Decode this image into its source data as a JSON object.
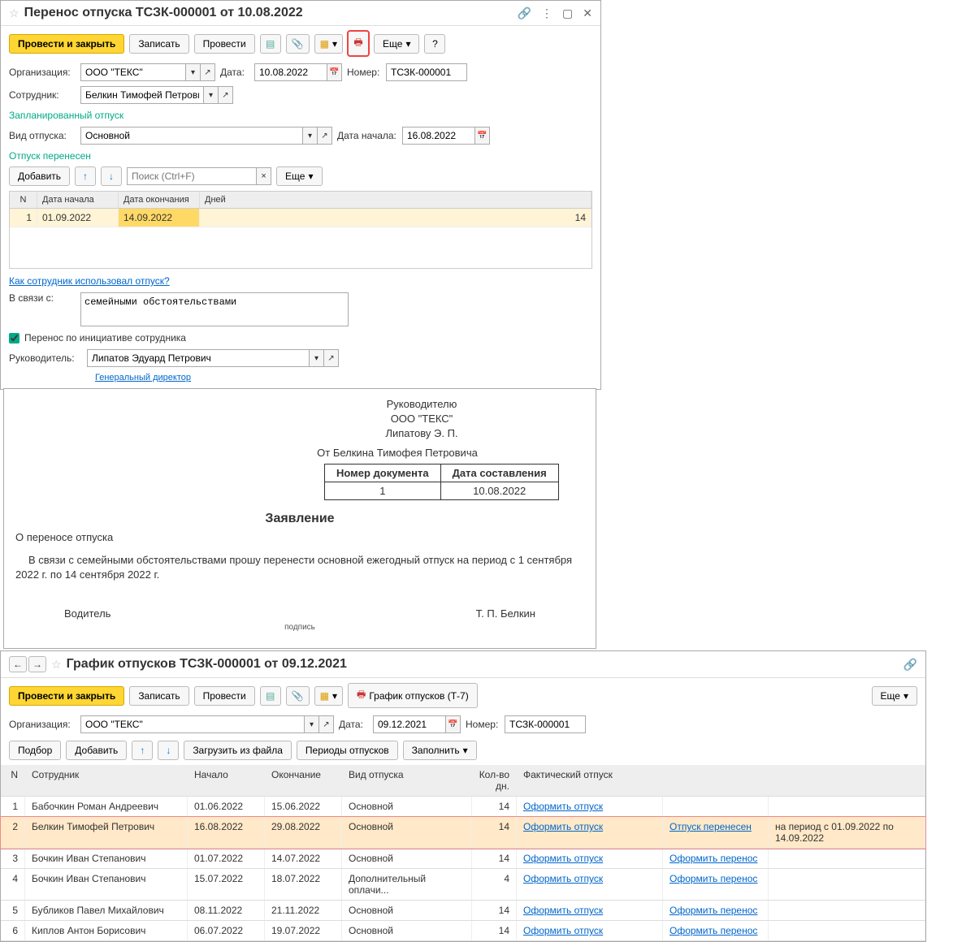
{
  "window1": {
    "title": "Перенос отпуска ТСЗК-000001 от 10.08.2022",
    "toolbar": {
      "post_close": "Провести и закрыть",
      "save": "Записать",
      "post": "Провести",
      "more": "Еще"
    },
    "fields": {
      "org_label": "Организация:",
      "org_value": "ООО \"ТЕКС\"",
      "date_label": "Дата:",
      "date_value": "10.08.2022",
      "number_label": "Номер:",
      "number_value": "ТСЗК-000001",
      "employee_label": "Сотрудник:",
      "employee_value": "Белкин Тимофей Петрович"
    },
    "planned_header": "Запланированный отпуск",
    "planned": {
      "type_label": "Вид отпуска:",
      "type_value": "Основной",
      "start_label": "Дата начала:",
      "start_value": "16.08.2022"
    },
    "transferred_header": "Отпуск перенесен",
    "table_toolbar": {
      "add": "Добавить",
      "search_placeholder": "Поиск (Ctrl+F)",
      "more": "Еще"
    },
    "table": {
      "col_n": "N",
      "col_start": "Дата начала",
      "col_end": "Дата окончания",
      "col_days": "Дней",
      "row": {
        "n": "1",
        "start": "01.09.2022",
        "end": "14.09.2022",
        "days": "14"
      }
    },
    "usage_link": "Как сотрудник использовал отпуск?",
    "reason_label": "В связи с:",
    "reason_value": "семейными обстоятельствами",
    "checkbox_label": "Перенос по инициативе сотрудника",
    "manager_label": "Руководитель:",
    "manager_value": "Липатов Эдуард Петрович",
    "manager_position": "Генеральный директор"
  },
  "document": {
    "to_line1": "Руководителю",
    "to_line2": "ООО \"ТЕКС\"",
    "to_line3": "Липатову Э. П.",
    "from": "От Белкина Тимофея Петровича",
    "doc_number_label": "Номер документа",
    "doc_date_label": "Дата составления",
    "doc_number": "1",
    "doc_date": "10.08.2022",
    "title": "Заявление",
    "subtitle": "О переносе отпуска",
    "body": "В связи с семейными обстоятельствами прошу перенести основной ежегодный отпуск на период с 1 сентября 2022 г. по 14 сентября 2022 г.",
    "position": "Водитель",
    "sig_label": "подпись",
    "name": "Т. П. Белкин"
  },
  "window3": {
    "title": "График отпусков ТСЗК-000001 от 09.12.2021",
    "toolbar": {
      "post_close": "Провести и закрыть",
      "save": "Записать",
      "post": "Провести",
      "print": "График отпусков (Т-7)",
      "more": "Еще"
    },
    "fields": {
      "org_label": "Организация:",
      "org_value": "ООО \"ТЕКС\"",
      "date_label": "Дата:",
      "date_value": "09.12.2021",
      "number_label": "Номер:",
      "number_value": "ТСЗК-000001"
    },
    "toolbar2": {
      "pick": "Подбор",
      "add": "Добавить",
      "load": "Загрузить из файла",
      "periods": "Периоды отпусков",
      "fill": "Заполнить"
    },
    "grid": {
      "h_n": "N",
      "h_emp": "Сотрудник",
      "h_start": "Начало",
      "h_end": "Окончание",
      "h_type": "Вид отпуска",
      "h_days": "Кол-во дн.",
      "h_actual": "Фактический отпуск",
      "rows": [
        {
          "n": "1",
          "emp": "Бабочкин Роман Андреевич",
          "st": "01.06.2022",
          "en": "15.06.2022",
          "type": "Основной",
          "days": "14",
          "act": "Оформить отпуск",
          "tr": "",
          "per": ""
        },
        {
          "n": "2",
          "emp": "Белкин Тимофей Петрович",
          "st": "16.08.2022",
          "en": "29.08.2022",
          "type": "Основной",
          "days": "14",
          "act": "Оформить отпуск",
          "tr": "Отпуск перенесен",
          "per": "на период с 01.09.2022 по 14.09.2022"
        },
        {
          "n": "3",
          "emp": "Бочкин Иван Степанович",
          "st": "01.07.2022",
          "en": "14.07.2022",
          "type": "Основной",
          "days": "14",
          "act": "Оформить отпуск",
          "tr": "Оформить перенос",
          "per": ""
        },
        {
          "n": "4",
          "emp": "Бочкин Иван Степанович",
          "st": "15.07.2022",
          "en": "18.07.2022",
          "type": "Дополнительный оплачи...",
          "days": "4",
          "act": "Оформить отпуск",
          "tr": "Оформить перенос",
          "per": ""
        },
        {
          "n": "5",
          "emp": "Бубликов Павел Михайлович",
          "st": "08.11.2022",
          "en": "21.11.2022",
          "type": "Основной",
          "days": "14",
          "act": "Оформить отпуск",
          "tr": "Оформить перенос",
          "per": ""
        },
        {
          "n": "6",
          "emp": "Киплов Антон Борисович",
          "st": "06.07.2022",
          "en": "19.07.2022",
          "type": "Основной",
          "days": "14",
          "act": "Оформить отпуск",
          "tr": "Оформить перенос",
          "per": ""
        }
      ]
    }
  }
}
